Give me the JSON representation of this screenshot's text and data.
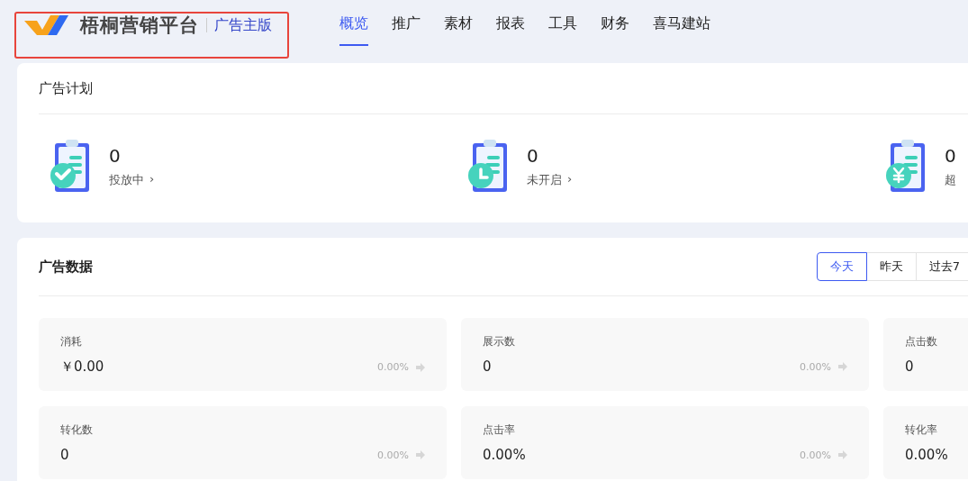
{
  "header": {
    "logo_text": "梧桐营销平台",
    "edition": "广告主版",
    "nav": [
      {
        "label": "概览",
        "selected": true
      },
      {
        "label": "推广",
        "selected": false
      },
      {
        "label": "素材",
        "selected": false
      },
      {
        "label": "报表",
        "selected": false
      },
      {
        "label": "工具",
        "selected": false
      },
      {
        "label": "财务",
        "selected": false
      },
      {
        "label": "喜马建站",
        "selected": false
      }
    ]
  },
  "plans": {
    "title": "广告计划",
    "stats": [
      {
        "kind": "check",
        "value": "0",
        "label": "投放中",
        "chevron": "›"
      },
      {
        "kind": "clock",
        "value": "0",
        "label": "未开启",
        "chevron": "›"
      },
      {
        "kind": "yen",
        "value": "0",
        "label": "超"
      }
    ]
  },
  "ad_data": {
    "title": "广告数据",
    "ranges": [
      {
        "label": "今天",
        "selected": true
      },
      {
        "label": "昨天",
        "selected": false
      },
      {
        "label": "过去7",
        "selected": false
      }
    ],
    "metrics": [
      {
        "label": "消耗",
        "value": "￥0.00",
        "change": "0.00%"
      },
      {
        "label": "展示数",
        "value": "0",
        "change": "0.00%"
      },
      {
        "label": "点击数",
        "value": "0"
      },
      {
        "label": "转化数",
        "value": "0",
        "change": "0.00%"
      },
      {
        "label": "点击率",
        "value": "0.00%",
        "change": "0.00%"
      },
      {
        "label": "转化率",
        "value": "0.00%"
      }
    ]
  }
}
